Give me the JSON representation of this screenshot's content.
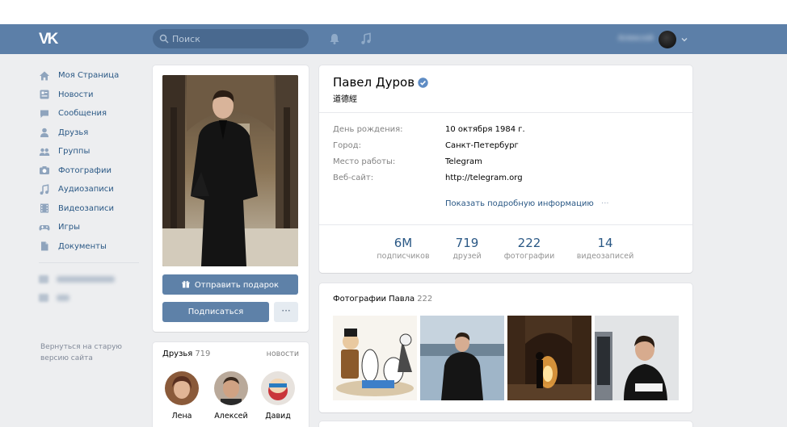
{
  "header": {
    "logo_text": "VK",
    "search_placeholder": "Поиск",
    "user_name": "Алексей"
  },
  "sidebar": {
    "items": [
      {
        "label": "Моя Страница",
        "icon": "home-icon"
      },
      {
        "label": "Новости",
        "icon": "news-icon"
      },
      {
        "label": "Сообщения",
        "icon": "messages-icon"
      },
      {
        "label": "Друзья",
        "icon": "friends-icon"
      },
      {
        "label": "Группы",
        "icon": "groups-icon"
      },
      {
        "label": "Фотографии",
        "icon": "camera-icon"
      },
      {
        "label": "Аудиозаписи",
        "icon": "music-icon"
      },
      {
        "label": "Видеозаписи",
        "icon": "video-icon"
      },
      {
        "label": "Игры",
        "icon": "gamepad-icon"
      },
      {
        "label": "Документы",
        "icon": "document-icon"
      }
    ],
    "old_version_link": "Вернуться на старую версию сайта"
  },
  "left_column": {
    "gift_button": "Отправить подарок",
    "subscribe_button": "Подписаться",
    "more_button": "···"
  },
  "friends": {
    "title": "Друзья",
    "count": "719",
    "link": "новости",
    "items": [
      {
        "name": "Лена"
      },
      {
        "name": "Алексей"
      },
      {
        "name": "Давид"
      }
    ]
  },
  "profile": {
    "name": "Павел Дуров",
    "status": "道德經",
    "info": [
      {
        "key": "День рождения:",
        "value": "10 октября 1984 г."
      },
      {
        "key": "Город:",
        "value": "Санкт-Петербург"
      },
      {
        "key": "Место работы:",
        "value": "Telegram"
      },
      {
        "key": "Веб-сайт:",
        "value": "http://telegram.org"
      }
    ],
    "show_more": "Показать подробную информацию",
    "show_more_dots": "···",
    "counters": [
      {
        "number": "6M",
        "label": "подписчиков"
      },
      {
        "number": "719",
        "label": "друзей"
      },
      {
        "number": "222",
        "label": "фотографии"
      },
      {
        "number": "14",
        "label": "видеозаписей"
      }
    ]
  },
  "photos": {
    "title": "Фотографии Павла",
    "count": "222"
  },
  "colors": {
    "header_bg": "#5c7fa8",
    "link": "#2a5885",
    "button_bg": "#5e81a8",
    "page_bg": "#edeef0"
  }
}
